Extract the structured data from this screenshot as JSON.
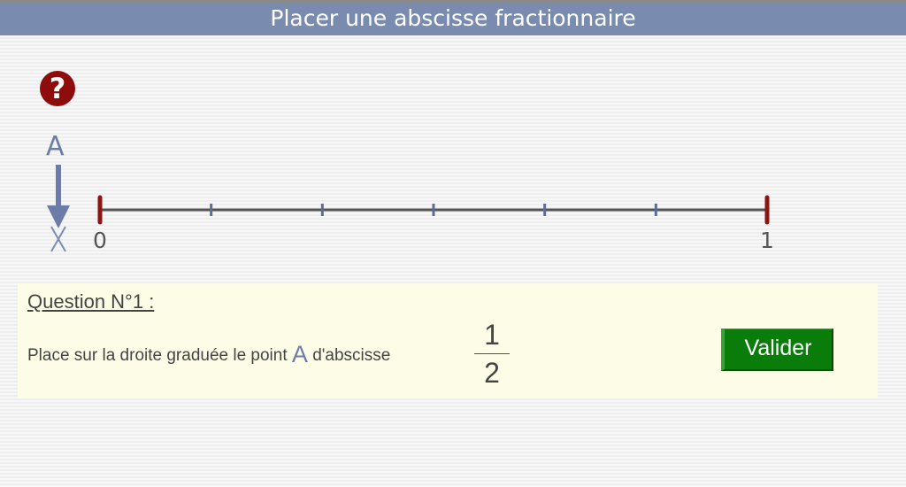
{
  "header": {
    "title": "Placer une abscisse fractionnaire"
  },
  "help": {
    "icon": "question-circle-icon",
    "symbol": "?",
    "color": "#8e0c0c"
  },
  "point": {
    "name": "A",
    "color": "#6b7ca8"
  },
  "number_line": {
    "start_label": "0",
    "end_label": "1",
    "subdivisions": 6,
    "endpoint_color": "#8e1414",
    "tick_color": "#5c6c96",
    "line_color": "#555555"
  },
  "question": {
    "title": "Question N°1 :",
    "instruction_before": "Place sur la droite graduée le point ",
    "point_name": "A",
    "instruction_after": " d'abscisse",
    "fraction_numerator": "1",
    "fraction_denominator": "2"
  },
  "actions": {
    "validate_label": "Valider",
    "validate_color": "#0a7c0a"
  }
}
